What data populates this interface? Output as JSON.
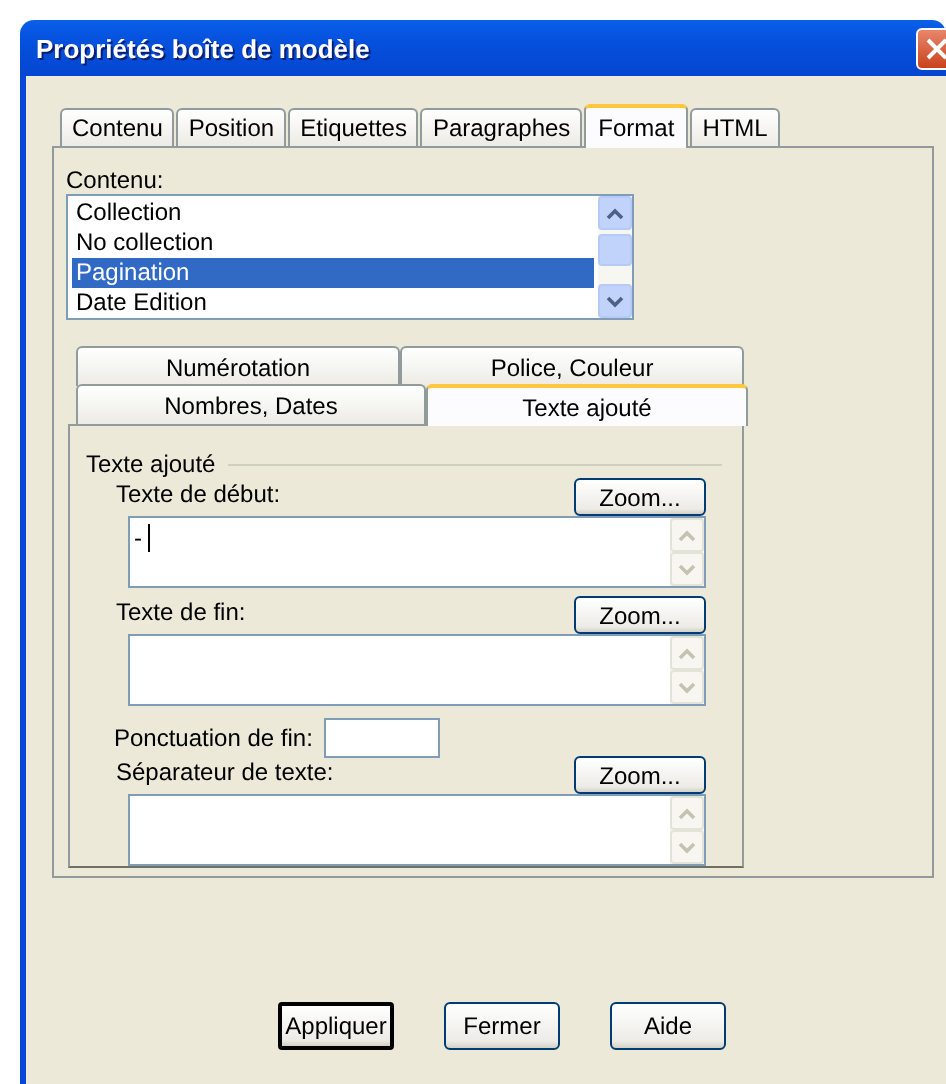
{
  "window": {
    "title": "Propriétés boîte de modèle"
  },
  "tabs": [
    {
      "label": "Contenu",
      "selected": false
    },
    {
      "label": "Position",
      "selected": false
    },
    {
      "label": "Etiquettes",
      "selected": false
    },
    {
      "label": "Paragraphes",
      "selected": false
    },
    {
      "label": "Format",
      "selected": true
    },
    {
      "label": "HTML",
      "selected": false
    }
  ],
  "content_list": {
    "label": "Contenu:",
    "items": [
      {
        "label": "Collection",
        "selected": false
      },
      {
        "label": "No collection",
        "selected": false
      },
      {
        "label": "Pagination",
        "selected": true
      },
      {
        "label": "Date Edition",
        "selected": false
      }
    ]
  },
  "sub_tabs": [
    [
      {
        "label": "Numérotation",
        "selected": false
      },
      {
        "label": "Police, Couleur",
        "selected": false
      }
    ],
    [
      {
        "label": "Nombres, Dates",
        "selected": false
      },
      {
        "label": "Texte ajouté",
        "selected": true
      }
    ]
  ],
  "group": {
    "title": "Texte ajouté",
    "fields": [
      {
        "kind": "textarea",
        "label": "Texte de début:",
        "value": "-",
        "focused": true,
        "button": "Zoom..."
      },
      {
        "kind": "textarea",
        "label": "Texte de fin:",
        "button": "Zoom..."
      },
      {
        "kind": "input",
        "label": "Ponctuation de fin:"
      },
      {
        "kind": "textarea",
        "label": "Séparateur de texte:",
        "button": "Zoom..."
      }
    ]
  },
  "buttons": [
    {
      "label": "Appliquer",
      "default": true
    },
    {
      "label": "Fermer",
      "default": false
    },
    {
      "label": "Aide",
      "default": false
    }
  ]
}
